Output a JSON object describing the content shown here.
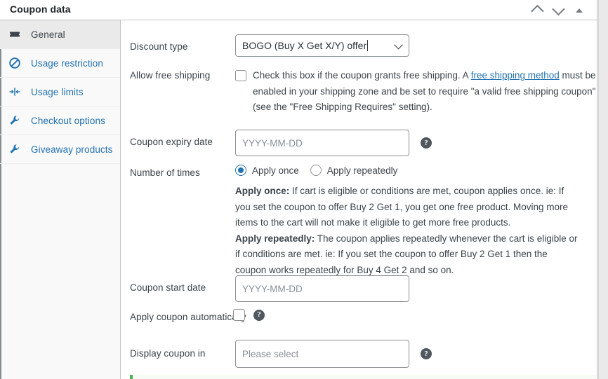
{
  "panel": {
    "title": "Coupon data",
    "header_buttons": [
      {
        "name": "move-up-button",
        "icon": "chevron-up-icon"
      },
      {
        "name": "move-down-button",
        "icon": "chevron-down-icon"
      },
      {
        "name": "toggle-panel-button",
        "icon": "triangle-up-icon"
      }
    ]
  },
  "sidebar": {
    "items": [
      {
        "label": "General",
        "icon": "ticket-icon",
        "active": true
      },
      {
        "label": "Usage restriction",
        "icon": "block-icon",
        "active": false
      },
      {
        "label": "Usage limits",
        "icon": "limits-icon",
        "active": false
      },
      {
        "label": "Checkout options",
        "icon": "wrench-icon",
        "active": false
      },
      {
        "label": "Giveaway products",
        "icon": "wrench-icon",
        "active": false
      }
    ]
  },
  "form": {
    "discount_type": {
      "label": "Discount type",
      "value": "BOGO (Buy X Get X/Y) offer"
    },
    "allow_free_shipping": {
      "label": "Allow free shipping",
      "checked": false,
      "text_before_link": "Check this box if the coupon grants free shipping. A ",
      "link_text": "free shipping method",
      "text_after_link": " must be enabled in your shipping zone and be set to require \"a valid free shipping coupon\" (see the \"Free Shipping Requires\" setting)."
    },
    "coupon_expiry_date": {
      "label": "Coupon expiry date",
      "value": "",
      "placeholder": "YYYY-MM-DD",
      "help": "?"
    },
    "number_of_times": {
      "label": "Number of times",
      "options": [
        {
          "label": "Apply once",
          "selected": true
        },
        {
          "label": "Apply repeatedly",
          "selected": false
        }
      ],
      "desc_once_title": "Apply once:",
      "desc_once_body": " If cart is eligible or conditions are met, coupon applies once. ie: If you set the coupon to offer Buy 2 Get 1, you get one free product. Moving more items to the cart will not make it eligible to get more free products.",
      "desc_repeat_title": "Apply repeatedly:",
      "desc_repeat_body": " The coupon applies repeatedly whenever the cart is eligible or if conditions are met. ie: If you set the coupon to offer Buy 2 Get 1 then the coupon works repeatedly for Buy 4 Get 2 and so on."
    },
    "coupon_start_date": {
      "label": "Coupon start date",
      "value": "",
      "placeholder": "YYYY-MM-DD"
    },
    "apply_coupon_automatically": {
      "label": "Apply coupon automatically",
      "checked": false,
      "help": "?"
    },
    "display_coupon_in": {
      "label": "Display coupon in",
      "value": "",
      "placeholder": "Please select",
      "help": "?"
    }
  },
  "colors": {
    "link": "#2271b1",
    "accent_blue": "#2271b1",
    "notice_green": "#46b450",
    "text": "#3c434a",
    "border": "#8c8f94"
  }
}
